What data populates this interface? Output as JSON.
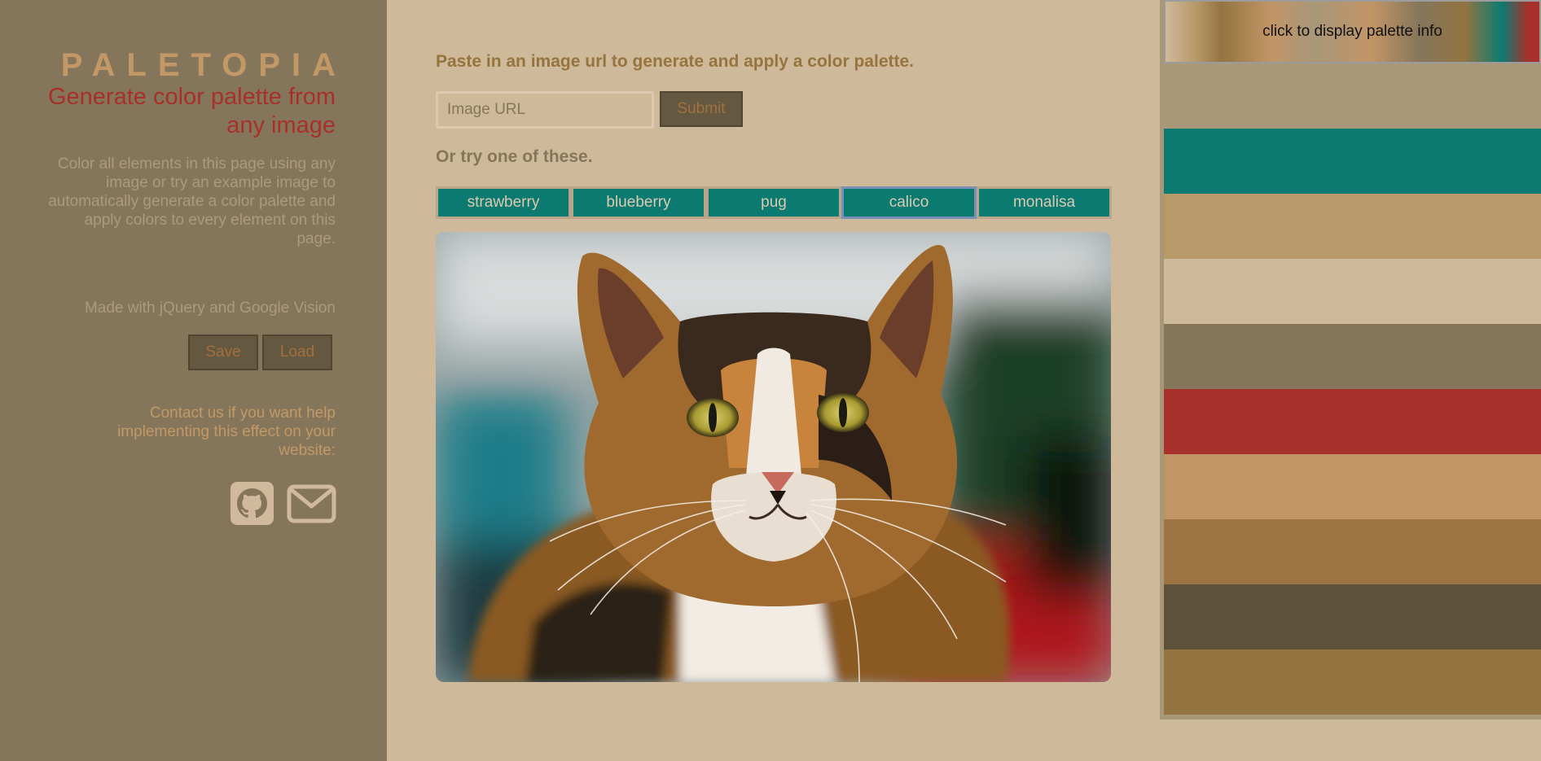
{
  "sidebar": {
    "brand": "PALETOPIA",
    "tagline": "Generate color palette from any image",
    "description": "Color all elements in this page using any image or try an example image to automatically generate a color palette and apply colors to every element on this page.",
    "made_with": "Made with jQuery and Google Vision",
    "save_label": "Save",
    "load_label": "Load",
    "contact": "Contact us if you want help implementing this effect on your website:",
    "icons": [
      "github-icon",
      "mail-icon"
    ]
  },
  "main": {
    "heading": "Paste in an image url to generate and apply a color palette.",
    "url_placeholder": "Image URL",
    "submit_label": "Submit",
    "try_heading": "Or try one of these.",
    "examples": [
      "strawberry",
      "blueberry",
      "pug",
      "calico",
      "monalisa"
    ],
    "selected_example": "calico"
  },
  "palette": {
    "header_label": "click to display palette info",
    "swatches": [
      "#a89779",
      "#0b7b72",
      "#b8996a",
      "#cfb99b",
      "#85765b",
      "#a8302a",
      "#c29566",
      "#9c7343",
      "#5e5139",
      "#937441"
    ]
  },
  "colors": {
    "page_bg": "#cfb99b",
    "sidebar_bg": "#85765b",
    "brand": "#c29966",
    "accent_red": "#a8302a",
    "button_bg": "#645840",
    "example_button_bg": "#0b7b72"
  }
}
